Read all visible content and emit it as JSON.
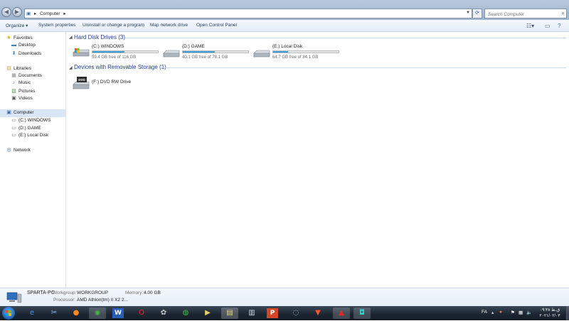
{
  "address": {
    "crumbs": [
      "Computer"
    ]
  },
  "search": {
    "placeholder": "Search Computer"
  },
  "toolbar": {
    "organize": "Organize",
    "system_properties": "System properties",
    "uninstall": "Uninstall or change a program",
    "map_drive": "Map network drive",
    "control_panel": "Open Control Panel"
  },
  "nav": {
    "favorites": "Favorites",
    "desktop": "Desktop",
    "downloads": "Downloads",
    "libraries": "Libraries",
    "documents": "Documents",
    "music": "Music",
    "pictures": "Pictures",
    "videos": "Videos",
    "computer": "Computer",
    "drive_c": "(C:) WINDOWS",
    "drive_d": "(D:) GAME",
    "drive_e": "(E:) Local Disk",
    "network": "Network"
  },
  "groups": {
    "hdd": "Hard Disk Drives (3)",
    "removable": "Devices with Removable Storage (1)"
  },
  "drives": [
    {
      "name": "(C:) WINDOWS",
      "free": "59.4 GB free of 116 GB",
      "used_fraction": 0.49
    },
    {
      "name": "(D:) GAME",
      "free": "40.1 GB free of 78.1 GB",
      "used_fraction": 0.49
    },
    {
      "name": "(E:) Local Disk",
      "free": "64.7 GB free of 84.1 GB",
      "used_fraction": 0.23
    }
  ],
  "removable": [
    {
      "name": "(F:) DVD RW Drive",
      "badge": "DVD"
    }
  ],
  "details": {
    "pc_name": "SPARTA-PC",
    "workgroup_label": "Workgroup:",
    "workgroup": "WORKGROUP",
    "memory_label": "Memory:",
    "memory": "4.00 GB",
    "processor_label": "Processor:",
    "processor": "AMD Athlon(tm) II X2 2..."
  },
  "tray": {
    "lang": "FA",
    "clock_time": "۰۹:۳۸ ق.ظ",
    "clock_date": "۲۰۲۱/۰۲/۰۳"
  },
  "colors": {
    "accent": "#268ad0",
    "link": "#1e3e8a"
  }
}
